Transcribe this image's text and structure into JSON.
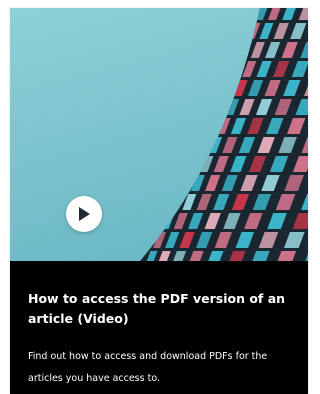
{
  "card": {
    "title": "How to access the PDF version of an article (Video)",
    "description": "Find out how to access and download PDFs for the articles you have access to.",
    "play_icon": "play-circle-icon",
    "colors": {
      "card_background": "#000000",
      "sky": "#7cc6d0",
      "building_frame": "#1a2630",
      "pane_cyan": "#3fc3d8",
      "pane_pink": "#e07a94",
      "pane_red": "#d6384e",
      "text": "#ffffff"
    }
  }
}
